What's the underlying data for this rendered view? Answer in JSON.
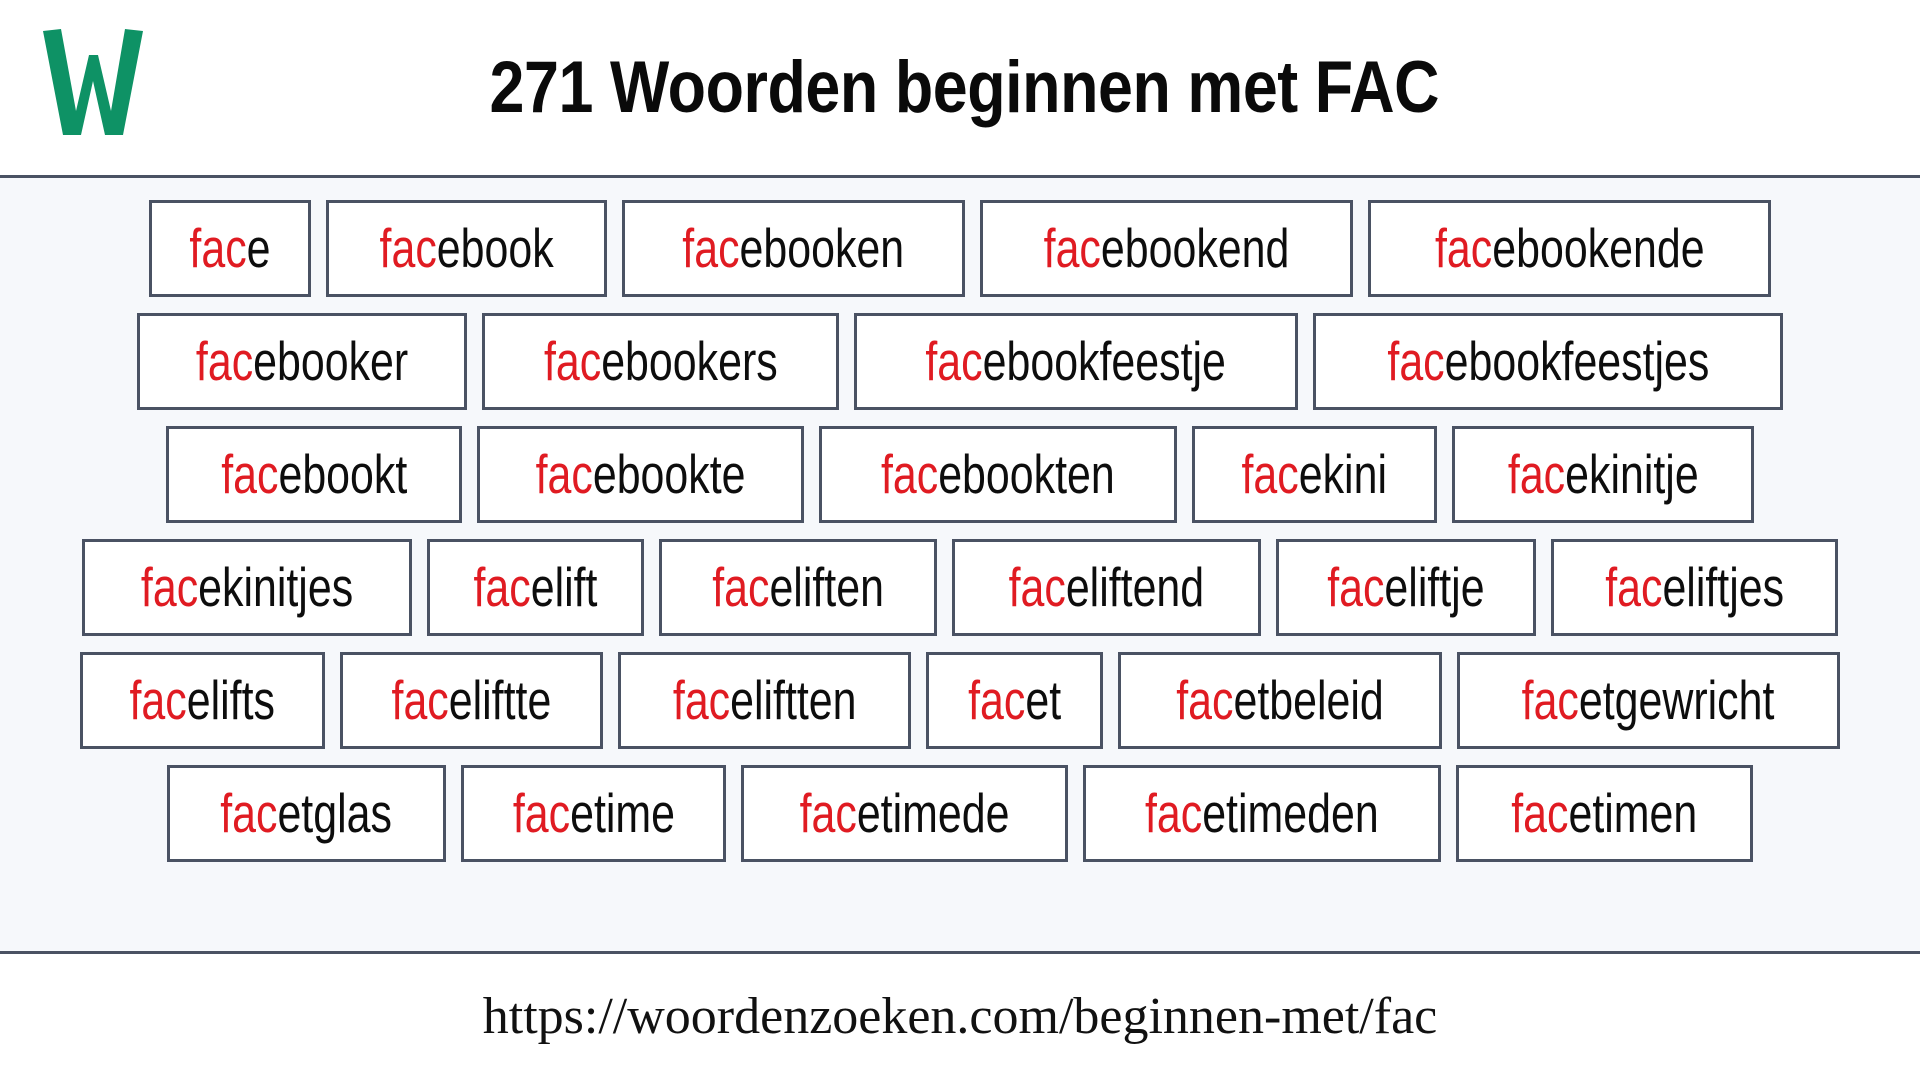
{
  "header": {
    "logo_icon": "w-logo-icon",
    "logo_letter": "W",
    "logo_color": "#0e9265",
    "title": "271 Woorden beginnen met FAC"
  },
  "content": {
    "highlight_prefix": "fac",
    "prefix_color": "#e01b22",
    "text_color": "#0d0d0d",
    "box_border_color": "#4a5263",
    "background_color": "#f6f8fb",
    "rows": [
      [
        "face",
        "facebook",
        "facebooken",
        "facebookend",
        "facebookende"
      ],
      [
        "facebooker",
        "facebookers",
        "facebookfeestje",
        "facebookfeestjes"
      ],
      [
        "facebookt",
        "facebookte",
        "facebookten",
        "facekini",
        "facekinitje"
      ],
      [
        "facekinitjes",
        "facelift",
        "faceliften",
        "faceliftend",
        "faceliftje",
        "faceliftjes"
      ],
      [
        "facelifts",
        "faceliftte",
        "faceliftten",
        "facet",
        "facetbeleid",
        "facetgewricht"
      ],
      [
        "facetglas",
        "facetime",
        "facetimede",
        "facetimeden",
        "facetimen"
      ]
    ]
  },
  "footer": {
    "url": "https://woordenzoeken.com/beginnen-met/fac"
  }
}
